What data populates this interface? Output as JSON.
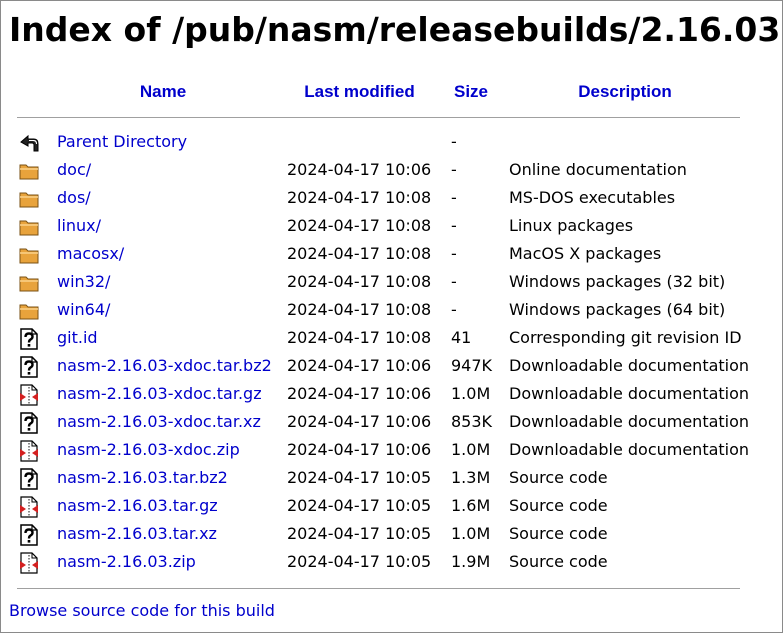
{
  "page": {
    "title": "Index of /pub/nasm/releasebuilds/2.16.03"
  },
  "columns": {
    "name": "Name",
    "last_modified": "Last modified",
    "size": "Size",
    "description": "Description"
  },
  "rows": [
    {
      "icon": "back",
      "name": "Parent Directory",
      "modified": "",
      "size": "-",
      "description": ""
    },
    {
      "icon": "folder",
      "name": "doc/",
      "modified": "2024-04-17 10:06",
      "size": "-",
      "description": "Online documentation"
    },
    {
      "icon": "folder",
      "name": "dos/",
      "modified": "2024-04-17 10:08",
      "size": "-",
      "description": "MS-DOS executables"
    },
    {
      "icon": "folder",
      "name": "linux/",
      "modified": "2024-04-17 10:08",
      "size": "-",
      "description": "Linux packages"
    },
    {
      "icon": "folder",
      "name": "macosx/",
      "modified": "2024-04-17 10:08",
      "size": "-",
      "description": "MacOS X packages"
    },
    {
      "icon": "folder",
      "name": "win32/",
      "modified": "2024-04-17 10:08",
      "size": "-",
      "description": "Windows packages (32 bit)"
    },
    {
      "icon": "folder",
      "name": "win64/",
      "modified": "2024-04-17 10:08",
      "size": "-",
      "description": "Windows packages (64 bit)"
    },
    {
      "icon": "unknown",
      "name": "git.id",
      "modified": "2024-04-17 10:08",
      "size": "41",
      "description": "Corresponding git revision ID"
    },
    {
      "icon": "unknown",
      "name": "nasm-2.16.03-xdoc.tar.bz2",
      "modified": "2024-04-17 10:06",
      "size": "947K",
      "description": "Downloadable documentation"
    },
    {
      "icon": "compressed",
      "name": "nasm-2.16.03-xdoc.tar.gz",
      "modified": "2024-04-17 10:06",
      "size": "1.0M",
      "description": "Downloadable documentation"
    },
    {
      "icon": "unknown",
      "name": "nasm-2.16.03-xdoc.tar.xz",
      "modified": "2024-04-17 10:06",
      "size": "853K",
      "description": "Downloadable documentation"
    },
    {
      "icon": "compressed",
      "name": "nasm-2.16.03-xdoc.zip",
      "modified": "2024-04-17 10:06",
      "size": "1.0M",
      "description": "Downloadable documentation"
    },
    {
      "icon": "unknown",
      "name": "nasm-2.16.03.tar.bz2",
      "modified": "2024-04-17 10:05",
      "size": "1.3M",
      "description": "Source code"
    },
    {
      "icon": "compressed",
      "name": "nasm-2.16.03.tar.gz",
      "modified": "2024-04-17 10:05",
      "size": "1.6M",
      "description": "Source code"
    },
    {
      "icon": "unknown",
      "name": "nasm-2.16.03.tar.xz",
      "modified": "2024-04-17 10:05",
      "size": "1.0M",
      "description": "Source code"
    },
    {
      "icon": "compressed",
      "name": "nasm-2.16.03.zip",
      "modified": "2024-04-17 10:05",
      "size": "1.9M",
      "description": "Source code"
    }
  ],
  "footer": {
    "link": "Browse source code for this build"
  },
  "colors": {
    "link": "#0000cc",
    "folder": "#e8a33c",
    "compressed_accent": "#d42020"
  }
}
